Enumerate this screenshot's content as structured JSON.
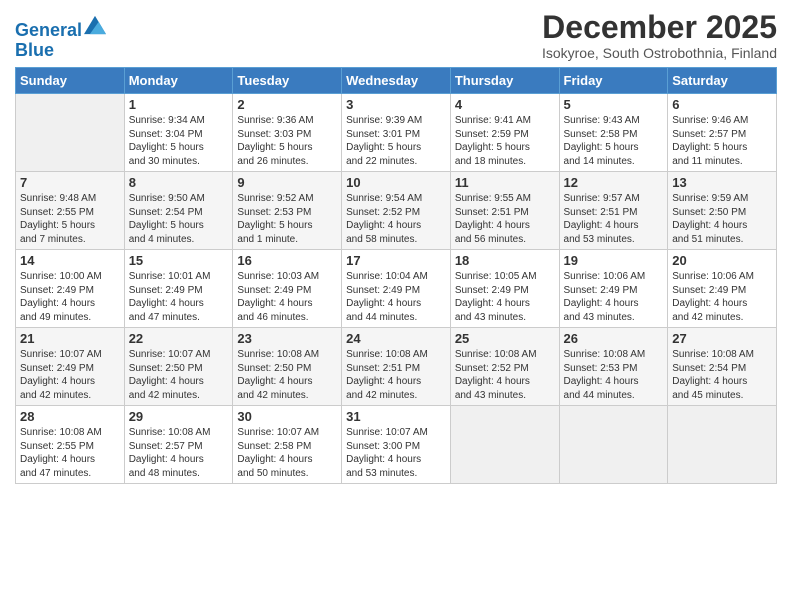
{
  "header": {
    "logo_line1": "General",
    "logo_line2": "Blue",
    "month_title": "December 2025",
    "subtitle": "Isokyroe, South Ostrobothnia, Finland"
  },
  "weekdays": [
    "Sunday",
    "Monday",
    "Tuesday",
    "Wednesday",
    "Thursday",
    "Friday",
    "Saturday"
  ],
  "weeks": [
    [
      {
        "day": "",
        "info": ""
      },
      {
        "day": "1",
        "info": "Sunrise: 9:34 AM\nSunset: 3:04 PM\nDaylight: 5 hours\nand 30 minutes."
      },
      {
        "day": "2",
        "info": "Sunrise: 9:36 AM\nSunset: 3:03 PM\nDaylight: 5 hours\nand 26 minutes."
      },
      {
        "day": "3",
        "info": "Sunrise: 9:39 AM\nSunset: 3:01 PM\nDaylight: 5 hours\nand 22 minutes."
      },
      {
        "day": "4",
        "info": "Sunrise: 9:41 AM\nSunset: 2:59 PM\nDaylight: 5 hours\nand 18 minutes."
      },
      {
        "day": "5",
        "info": "Sunrise: 9:43 AM\nSunset: 2:58 PM\nDaylight: 5 hours\nand 14 minutes."
      },
      {
        "day": "6",
        "info": "Sunrise: 9:46 AM\nSunset: 2:57 PM\nDaylight: 5 hours\nand 11 minutes."
      }
    ],
    [
      {
        "day": "7",
        "info": "Sunrise: 9:48 AM\nSunset: 2:55 PM\nDaylight: 5 hours\nand 7 minutes."
      },
      {
        "day": "8",
        "info": "Sunrise: 9:50 AM\nSunset: 2:54 PM\nDaylight: 5 hours\nand 4 minutes."
      },
      {
        "day": "9",
        "info": "Sunrise: 9:52 AM\nSunset: 2:53 PM\nDaylight: 5 hours\nand 1 minute."
      },
      {
        "day": "10",
        "info": "Sunrise: 9:54 AM\nSunset: 2:52 PM\nDaylight: 4 hours\nand 58 minutes."
      },
      {
        "day": "11",
        "info": "Sunrise: 9:55 AM\nSunset: 2:51 PM\nDaylight: 4 hours\nand 56 minutes."
      },
      {
        "day": "12",
        "info": "Sunrise: 9:57 AM\nSunset: 2:51 PM\nDaylight: 4 hours\nand 53 minutes."
      },
      {
        "day": "13",
        "info": "Sunrise: 9:59 AM\nSunset: 2:50 PM\nDaylight: 4 hours\nand 51 minutes."
      }
    ],
    [
      {
        "day": "14",
        "info": "Sunrise: 10:00 AM\nSunset: 2:49 PM\nDaylight: 4 hours\nand 49 minutes."
      },
      {
        "day": "15",
        "info": "Sunrise: 10:01 AM\nSunset: 2:49 PM\nDaylight: 4 hours\nand 47 minutes."
      },
      {
        "day": "16",
        "info": "Sunrise: 10:03 AM\nSunset: 2:49 PM\nDaylight: 4 hours\nand 46 minutes."
      },
      {
        "day": "17",
        "info": "Sunrise: 10:04 AM\nSunset: 2:49 PM\nDaylight: 4 hours\nand 44 minutes."
      },
      {
        "day": "18",
        "info": "Sunrise: 10:05 AM\nSunset: 2:49 PM\nDaylight: 4 hours\nand 43 minutes."
      },
      {
        "day": "19",
        "info": "Sunrise: 10:06 AM\nSunset: 2:49 PM\nDaylight: 4 hours\nand 43 minutes."
      },
      {
        "day": "20",
        "info": "Sunrise: 10:06 AM\nSunset: 2:49 PM\nDaylight: 4 hours\nand 42 minutes."
      }
    ],
    [
      {
        "day": "21",
        "info": "Sunrise: 10:07 AM\nSunset: 2:49 PM\nDaylight: 4 hours\nand 42 minutes."
      },
      {
        "day": "22",
        "info": "Sunrise: 10:07 AM\nSunset: 2:50 PM\nDaylight: 4 hours\nand 42 minutes."
      },
      {
        "day": "23",
        "info": "Sunrise: 10:08 AM\nSunset: 2:50 PM\nDaylight: 4 hours\nand 42 minutes."
      },
      {
        "day": "24",
        "info": "Sunrise: 10:08 AM\nSunset: 2:51 PM\nDaylight: 4 hours\nand 42 minutes."
      },
      {
        "day": "25",
        "info": "Sunrise: 10:08 AM\nSunset: 2:52 PM\nDaylight: 4 hours\nand 43 minutes."
      },
      {
        "day": "26",
        "info": "Sunrise: 10:08 AM\nSunset: 2:53 PM\nDaylight: 4 hours\nand 44 minutes."
      },
      {
        "day": "27",
        "info": "Sunrise: 10:08 AM\nSunset: 2:54 PM\nDaylight: 4 hours\nand 45 minutes."
      }
    ],
    [
      {
        "day": "28",
        "info": "Sunrise: 10:08 AM\nSunset: 2:55 PM\nDaylight: 4 hours\nand 47 minutes."
      },
      {
        "day": "29",
        "info": "Sunrise: 10:08 AM\nSunset: 2:57 PM\nDaylight: 4 hours\nand 48 minutes."
      },
      {
        "day": "30",
        "info": "Sunrise: 10:07 AM\nSunset: 2:58 PM\nDaylight: 4 hours\nand 50 minutes."
      },
      {
        "day": "31",
        "info": "Sunrise: 10:07 AM\nSunset: 3:00 PM\nDaylight: 4 hours\nand 53 minutes."
      },
      {
        "day": "",
        "info": ""
      },
      {
        "day": "",
        "info": ""
      },
      {
        "day": "",
        "info": ""
      }
    ]
  ]
}
